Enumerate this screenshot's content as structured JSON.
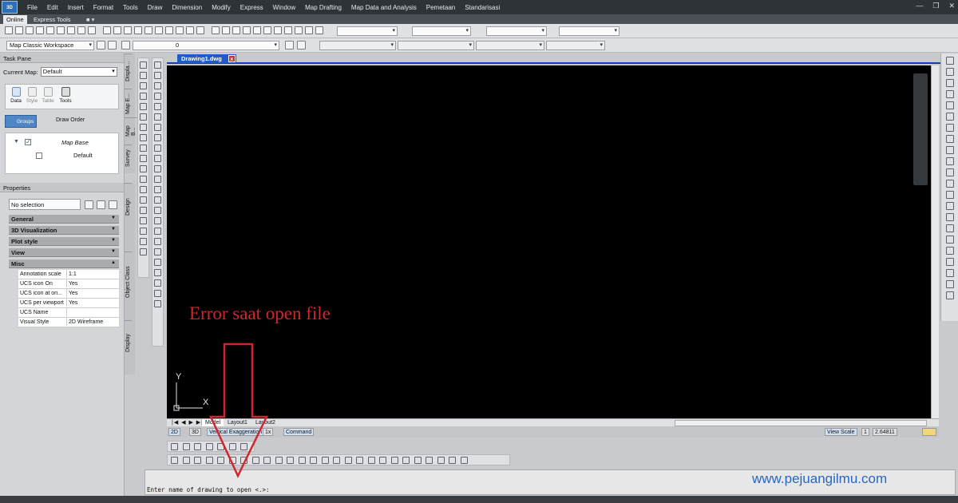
{
  "app": {
    "logo": "3D"
  },
  "menu": [
    "File",
    "Edit",
    "Insert",
    "Format",
    "Tools",
    "Draw",
    "Dimension",
    "Modify",
    "Express",
    "Window",
    "Map Drafting",
    "Map Data and Analysis",
    "Pemetaan",
    "Standarisasi"
  ],
  "ribbon_tabs": {
    "online": "Online",
    "express": "Express Tools"
  },
  "toolbar": {
    "workspace": "Map Classic Workspace",
    "layer_value": "0"
  },
  "task_pane": {
    "title": "Task Pane",
    "current_map_label": "Current Map:",
    "current_map_value": "Default",
    "modes": [
      "Data",
      "Style",
      "Table",
      "Tools"
    ],
    "groups_button": "Groups",
    "draw_order_button": "Draw Order",
    "layer_group": "Map Base",
    "layer": "Default"
  },
  "side_tabs_top": [
    "Displa...",
    "Map E...",
    "Map B...",
    "Survey"
  ],
  "side_tabs_bottom": [
    "Design",
    "Object Class",
    "Display"
  ],
  "properties": {
    "title": "Properties",
    "selection": "No selection",
    "categories": [
      "General",
      "3D Visualization",
      "Plot style",
      "View",
      "Misc"
    ],
    "rows": [
      {
        "key": "Annotation scale",
        "value": "1:1"
      },
      {
        "key": "UCS icon On",
        "value": "Yes"
      },
      {
        "key": "UCS icon at ori...",
        "value": "Yes"
      },
      {
        "key": "UCS per viewport",
        "value": "Yes"
      },
      {
        "key": "UCS Name",
        "value": ""
      },
      {
        "key": "Visual Style",
        "value": "2D Wireframe"
      }
    ]
  },
  "document": {
    "tab": "Drawing1.dwg",
    "close": "x"
  },
  "ucs": {
    "x": "X",
    "y": "Y"
  },
  "layout_tabs": [
    "Model",
    "Layout1",
    "Layout2"
  ],
  "status": {
    "mode_2d": "2D",
    "mode_3d": "3D",
    "vertical_exaggeration": "Vertical Exaggeration",
    "exaggeration_value": "1x",
    "command": "Command",
    "view_scale_label": "View Scale",
    "view_scale_value": "1",
    "scale_number": "2.64811"
  },
  "command_line": "Enter name of drawing to open <.>:",
  "annotation": {
    "caption": "Error saat open file",
    "watermark": "www.pejuangilmu.com",
    "arrow_color": "#d0262e"
  }
}
